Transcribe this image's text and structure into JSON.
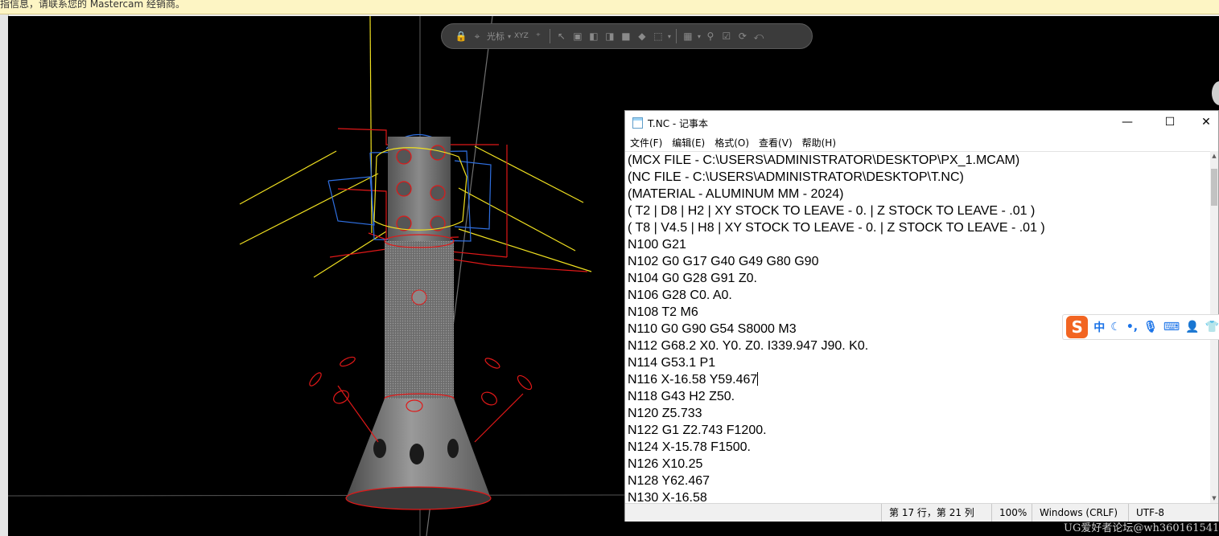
{
  "notice_bar": {
    "text": "指信息，请联系您的 Mastercam 经销商。"
  },
  "quick_toolbar": {
    "label": "光标",
    "axis_label": "XYZ"
  },
  "notepad": {
    "title": "T.NC - 记事本",
    "window_controls": {
      "minimize": "—",
      "maximize": "☐",
      "close": "✕"
    },
    "menus": [
      "文件(F)",
      "编辑(E)",
      "格式(O)",
      "查看(V)",
      "帮助(H)"
    ],
    "lines": [
      "(MCX FILE - C:\\USERS\\ADMINISTRATOR\\DESKTOP\\PX_1.MCAM)",
      "(NC FILE - C:\\USERS\\ADMINISTRATOR\\DESKTOP\\T.NC)",
      "(MATERIAL - ALUMINUM MM - 2024)",
      "( T2 | D8 | H2 | XY STOCK TO LEAVE - 0. | Z STOCK TO LEAVE - .01 )",
      "( T8 | V4.5 | H8 | XY STOCK TO LEAVE - 0. | Z STOCK TO LEAVE - .01 )",
      "N100 G21",
      "N102 G0 G17 G40 G49 G80 G90",
      "N104 G0 G28 G91 Z0.",
      "N106 G28 C0. A0.",
      "N108 T2 M6",
      "N110 G0 G90 G54 S8000 M3",
      "N112 G68.2 X0. Y0. Z0. I339.947 J90. K0.",
      "N114 G53.1 P1",
      "N116 X-16.58 Y59.467",
      "N118 G43 H2 Z50.",
      "N120 Z5.733",
      "N122 G1 Z2.743 F1200.",
      "N124 X-15.78 F1500.",
      "N126 X10.25",
      "N128 Y62.467",
      "N130 X-16.58"
    ],
    "caret_line_index": 13,
    "status": {
      "position": "第 17 行，第 21 列",
      "zoom": "100%",
      "line_ending": "Windows (CRLF)",
      "encoding": "UTF-8"
    }
  },
  "ime_bar": {
    "logo": "S",
    "mode": "中",
    "items": [
      "moon-icon",
      "punctuation-icon",
      "microphone-icon",
      "keyboard-icon",
      "user-icon",
      "shirt-icon"
    ]
  },
  "watermark": {
    "text": "UG爱好者论坛@wh360161541"
  },
  "colors": {
    "viewport_bg": "#000000",
    "wire_red": "#e01818",
    "wire_blue": "#2f6fe0",
    "wire_yellow": "#f0e020",
    "model_grey": "#7d7d7d",
    "ime_orange": "#f26522"
  }
}
